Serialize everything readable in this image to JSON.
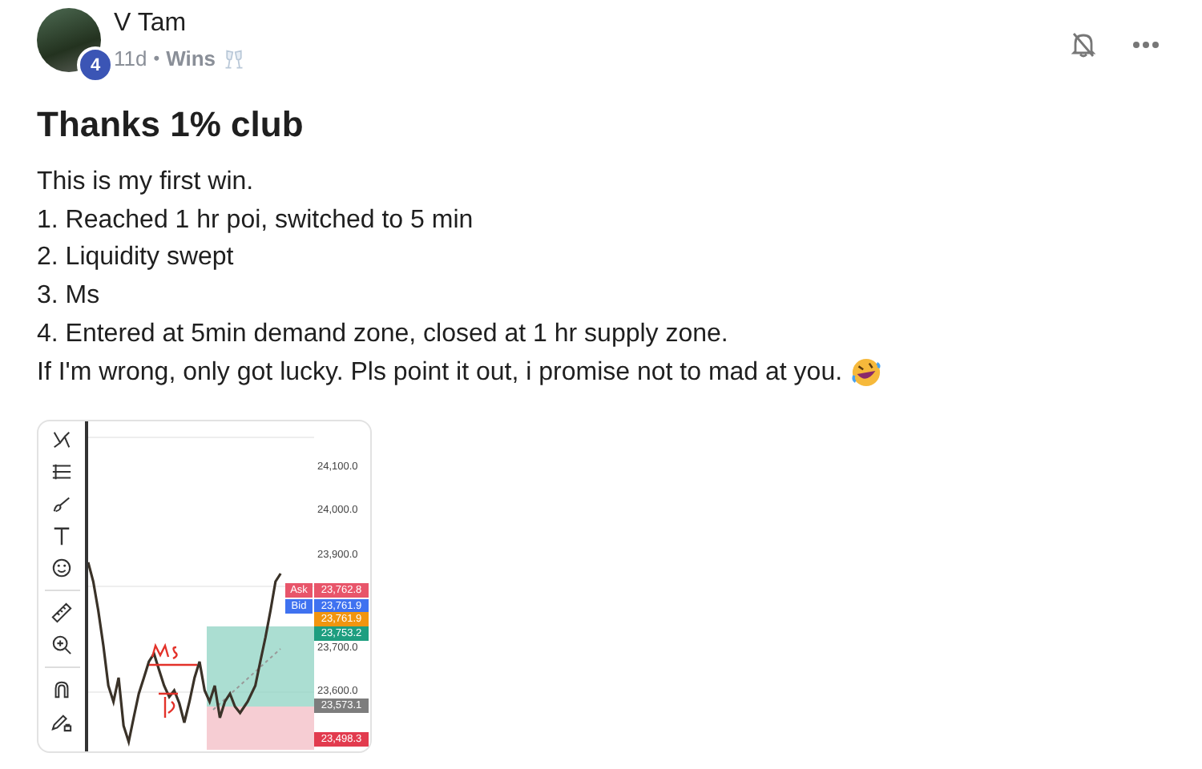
{
  "author": {
    "name": "V Tam",
    "level_badge": "4",
    "time": "11d",
    "separator": "•",
    "category": "Wins"
  },
  "post": {
    "title": "Thanks 1% club",
    "body": [
      "This is my first win.",
      "1. Reached 1 hr poi, switched to 5 min",
      "2. Liquidity swept",
      "3. Ms",
      "4. Entered at 5min demand zone, closed at 1 hr supply zone.",
      "If I'm wrong, only got lucky. Pls point it out, i promise not to mad at you."
    ]
  },
  "screenshot": {
    "price_ticks": [
      "24,100.0",
      "24,000.0",
      "23,900.0",
      "23,700.0",
      "23,600.0"
    ],
    "quote_tags": [
      {
        "text": "Ask",
        "color": "#e8556a"
      },
      {
        "text": "Bid",
        "color": "#3f72f0"
      }
    ],
    "price_tags": [
      {
        "text": "23,762.8",
        "color": "#e8556a"
      },
      {
        "text": "23,761.9",
        "color": "#3f72f0"
      },
      {
        "text": "23,761.9",
        "color": "#f2950f"
      },
      {
        "text": "23,753.2",
        "color": "#1e9e80"
      },
      {
        "text": "23,573.1",
        "color": "#7d7d7d"
      },
      {
        "text": "23,498.3",
        "color": "#e23b4e"
      }
    ]
  }
}
